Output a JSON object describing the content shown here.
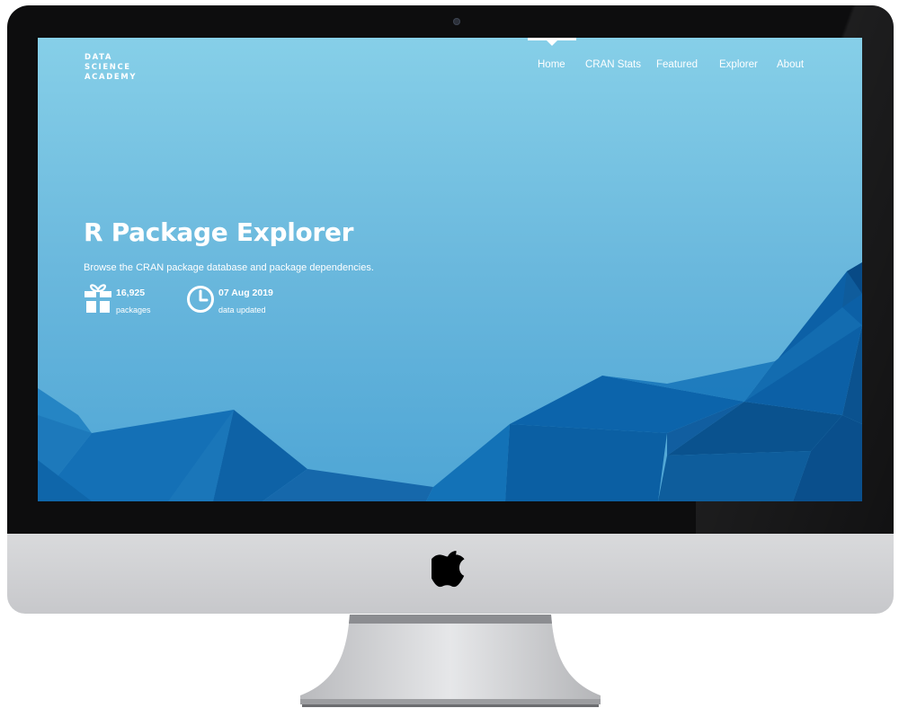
{
  "site": {
    "brand_lines": [
      "DATA",
      "SCIENCE",
      "ACADEMY"
    ],
    "nav": {
      "items": [
        "Home",
        "CRAN Stats",
        "Featured",
        "Explorer",
        "About"
      ],
      "active": "Home"
    }
  },
  "hero": {
    "title": "R Package Explorer",
    "subtitle": "Browse the CRAN package database and package dependencies.",
    "stats": [
      {
        "icon": "gift-icon",
        "value": "16,925",
        "label": "packages"
      },
      {
        "icon": "clock-icon",
        "value": "07 Aug 2019",
        "label": "data updated"
      }
    ]
  },
  "device": {
    "logo": "apple-logo"
  },
  "colors": {
    "sky_top": "#86cfe8",
    "sky_bottom": "#4ea5d5",
    "mountain_dark": "#0a4f8c",
    "mountain_mid": "#0d66ad",
    "mountain_light": "#1a7fc2",
    "bezel": "#0d0d0e",
    "chin": "#d0d1d4"
  }
}
